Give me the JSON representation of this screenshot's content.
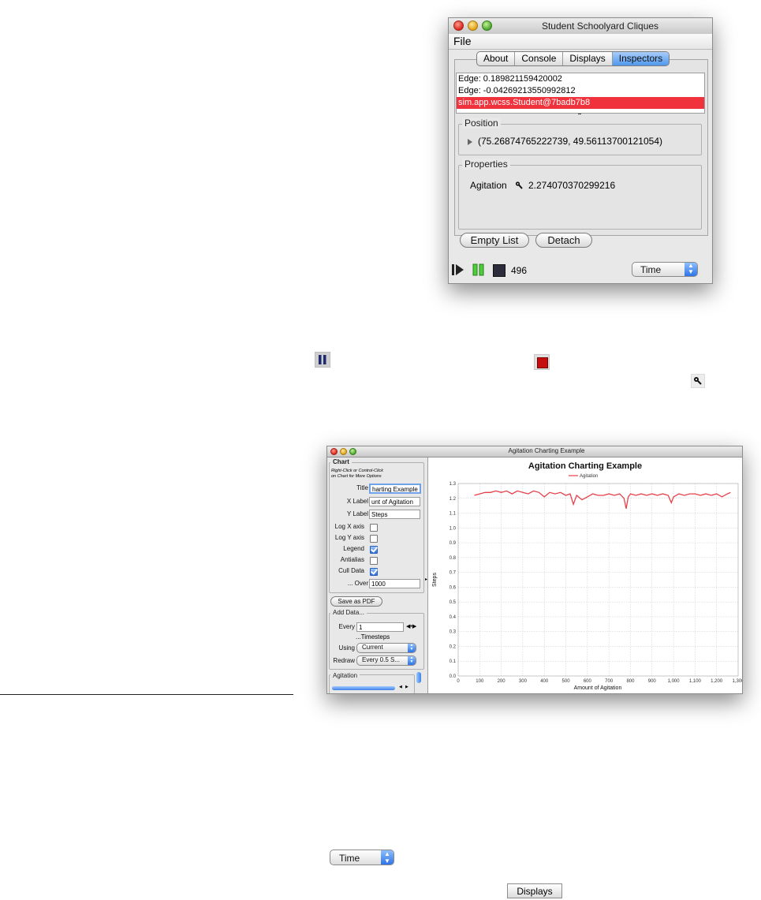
{
  "console_window": {
    "title": "Student Schoolyard Cliques",
    "menu": [
      "File"
    ],
    "tabs": [
      "About",
      "Console",
      "Displays",
      "Inspectors"
    ],
    "selected_tab": "Inspectors",
    "inspector_list": [
      "Edge: 0.189821159420002",
      "Edge: -0.04269213550992812",
      "sim.app.wcss.Student@7badb7b8"
    ],
    "position_legend": "Position",
    "position_value": "(75.26874765222739, 49.56113700121054)",
    "properties_legend": "Properties",
    "property_name": "Agitation",
    "property_value": "2.274070370299216",
    "empty_list_label": "Empty List",
    "detach_label": "Detach",
    "step_count": "496",
    "time_popup": "Time",
    "selection_color": "#f0323c",
    "tab_selected_color": "#4f97ec"
  },
  "chart_window": {
    "title": "Agitation Charting Example",
    "chart_group": "Chart",
    "hint": [
      "Right-Click or Control-Click",
      "on Chart for More Options"
    ],
    "title_label": "Title",
    "title_value": "harting Example",
    "xlabel_label": "X Label",
    "xlabel_value": "unt of Agitation",
    "ylabel_label": "Y Label",
    "ylabel_value": "Steps",
    "logx_label": "Log X axis",
    "logy_label": "Log Y axis",
    "legend_label": "Legend",
    "antialias_label": "Antialias",
    "cull_label": "Cull Data",
    "over_label": "... Over",
    "over_value": "1000",
    "save_pdf_label": "Save as PDF",
    "add_data_group": "Add Data...",
    "every_label": "Every",
    "every_value": "1",
    "timesteps_label": "...Timesteps",
    "using_label": "Using",
    "using_value": "Current",
    "redraw_label": "Redraw",
    "redraw_value": "Every 0.5 S...",
    "series_group": "Agitation"
  },
  "chart_data": {
    "type": "line",
    "title": "Agitation Charting Example",
    "xlabel": "Amount of Agitation",
    "ylabel": "Steps",
    "legend": "top-center",
    "grid": true,
    "xlim": [
      0,
      1300
    ],
    "ylim": [
      0.0,
      1.3
    ],
    "x_ticks": [
      "0",
      "100",
      "200",
      "300",
      "400",
      "500",
      "600",
      "700",
      "800",
      "900",
      "1,000",
      "1,100",
      "1,200",
      "1,300"
    ],
    "y_ticks": [
      "0.0",
      "0.1",
      "0.2",
      "0.3",
      "0.4",
      "0.5",
      "0.6",
      "0.7",
      "0.8",
      "0.9",
      "1.0",
      "1.1",
      "1.2",
      "1.3"
    ],
    "series": [
      {
        "name": "Agitation",
        "color": "#e8404a",
        "x": [
          75,
          100,
          125,
          150,
          175,
          200,
          225,
          250,
          275,
          300,
          325,
          350,
          375,
          400,
          425,
          450,
          475,
          500,
          520,
          535,
          550,
          575,
          600,
          625,
          650,
          675,
          700,
          725,
          750,
          770,
          780,
          790,
          800,
          825,
          850,
          875,
          900,
          925,
          950,
          975,
          990,
          1000,
          1025,
          1050,
          1075,
          1100,
          1125,
          1150,
          1175,
          1200,
          1225,
          1250,
          1265
        ],
        "y": [
          1.22,
          1.23,
          1.24,
          1.24,
          1.25,
          1.24,
          1.25,
          1.23,
          1.25,
          1.24,
          1.23,
          1.25,
          1.24,
          1.21,
          1.24,
          1.23,
          1.24,
          1.22,
          1.23,
          1.16,
          1.22,
          1.19,
          1.21,
          1.23,
          1.22,
          1.22,
          1.23,
          1.22,
          1.23,
          1.2,
          1.13,
          1.21,
          1.23,
          1.22,
          1.23,
          1.22,
          1.23,
          1.22,
          1.23,
          1.22,
          1.17,
          1.21,
          1.23,
          1.22,
          1.23,
          1.23,
          1.22,
          1.23,
          1.22,
          1.23,
          1.21,
          1.23,
          1.24
        ]
      }
    ]
  },
  "floating_widgets": {
    "time_popup": "Time",
    "displays_tab": "Displays"
  }
}
